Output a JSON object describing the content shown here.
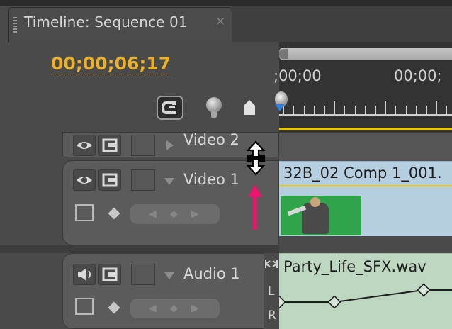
{
  "panel": {
    "tab_title": "Timeline: Sequence 01",
    "close_glyph": "×"
  },
  "header": {
    "timecode": "00;00;06;17",
    "tools": {
      "snap_icon": "snap-magnet-icon",
      "marker_icon": "set-marker-icon",
      "keyframe_icon": "set-encore-chapter-marker-icon"
    }
  },
  "ruler": {
    "labels": [
      ";00;00",
      "00;00;"
    ]
  },
  "tracks": [
    {
      "id": "video2",
      "label": "Video 2",
      "expanded": false,
      "icons": [
        "eye-icon",
        "filmstrip-icon"
      ]
    },
    {
      "id": "video1",
      "label": "Video 1",
      "expanded": true,
      "icons": [
        "eye-icon",
        "filmstrip-icon",
        "display-style-icon",
        "keyframe-diamond-icon"
      ],
      "clip": {
        "name": "32B_02 Comp 1_001."
      }
    },
    {
      "id": "audio1",
      "label": "Audio 1",
      "expanded": true,
      "icons": [
        "speaker-icon",
        "filmstrip-icon",
        "display-style-icon",
        "keyframe-diamond-icon"
      ],
      "clip": {
        "name": "Party_Life_SFX.wav"
      },
      "channels": [
        "L",
        "R"
      ]
    }
  ],
  "overlay": {
    "cursor_icon": "resize-vertical-cursor-icon",
    "annotation_icon": "pink-arrow-up-icon",
    "annotation_color": "#e8176b"
  }
}
